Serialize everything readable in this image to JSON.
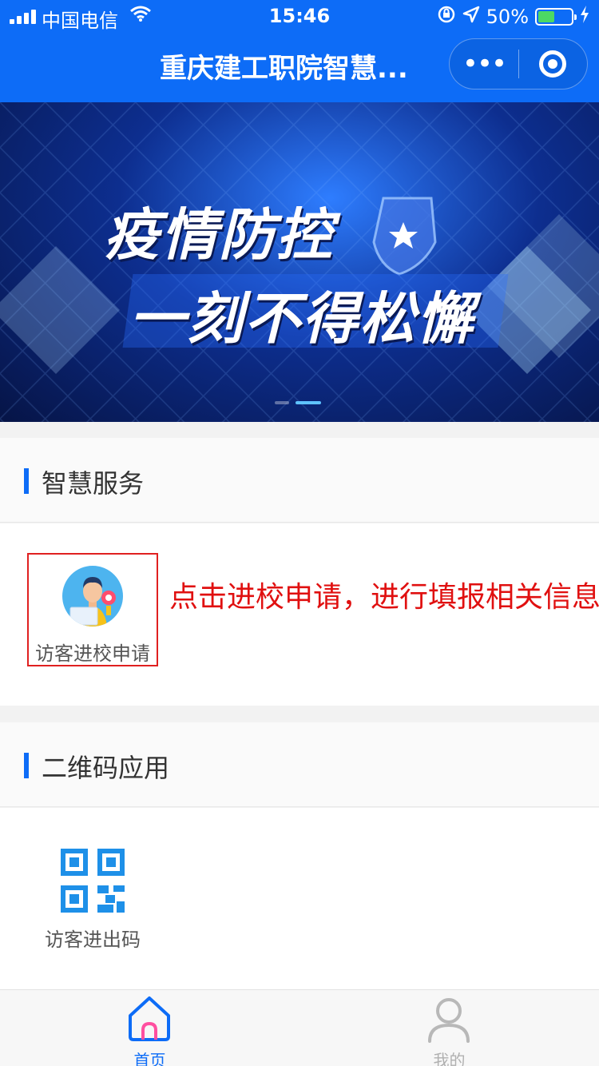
{
  "status_bar": {
    "carrier": "中国电信",
    "time": "15:46",
    "battery": "50%",
    "battery_level": 0.5,
    "icons": [
      "signal-icon",
      "wifi-icon",
      "rotation-lock-icon",
      "location-arrow-icon",
      "battery-icon",
      "charging-icon"
    ]
  },
  "nav": {
    "title": "重庆建工职院智慧...",
    "more_label": "•••",
    "icons": [
      "more-icon",
      "close-icon"
    ]
  },
  "banner": {
    "line1": "疫情防控",
    "line2": "一刻不得松懈",
    "slide_count": 2,
    "active_slide": 2
  },
  "sections": {
    "smart_service": {
      "title": "智慧服务",
      "items": [
        {
          "label": "访客进校申请",
          "icon": "visitor-icon"
        }
      ],
      "annotation": "点击进校申请，进行填报相关信息"
    },
    "qr_apps": {
      "title": "二维码应用",
      "items": [
        {
          "label": "访客进出码",
          "icon": "qr-code-icon"
        }
      ]
    }
  },
  "tabbar": {
    "tabs": [
      {
        "label": "首页",
        "icon": "home-icon",
        "active": true
      },
      {
        "label": "我的",
        "icon": "user-icon",
        "active": false
      }
    ],
    "active_color": "#0d6cf7",
    "inactive_color": "#b0b0b0"
  },
  "colors": {
    "brand": "#0d6cf7",
    "annotation": "#e01010",
    "battery_fill": "#4cd964"
  }
}
